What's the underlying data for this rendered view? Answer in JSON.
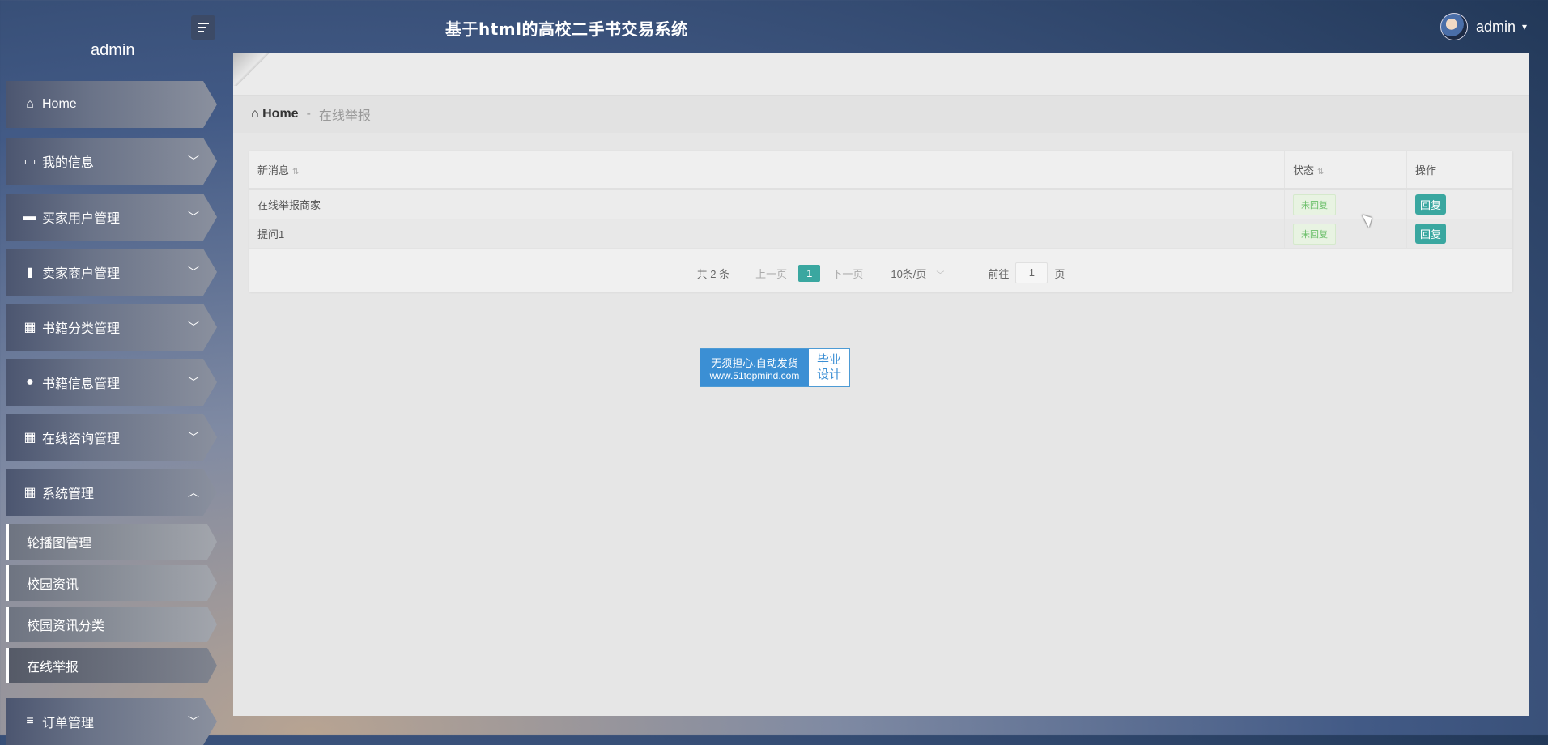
{
  "header": {
    "title": "基于html的高校二手书交易系统",
    "user_name": "admin",
    "caret": "▾"
  },
  "sidebar": {
    "user_label": "admin",
    "items": [
      {
        "label": "Home",
        "icon": "home-icon",
        "glyph": "⌂"
      },
      {
        "label": "我的信息",
        "icon": "card-icon",
        "glyph": "▭"
      },
      {
        "label": "买家用户管理",
        "icon": "monitor-icon",
        "glyph": "▬"
      },
      {
        "label": "卖家商户管理",
        "icon": "book-icon",
        "glyph": "▮"
      },
      {
        "label": "书籍分类管理",
        "icon": "grid-icon",
        "glyph": "▦"
      },
      {
        "label": "书籍信息管理",
        "icon": "user-icon",
        "glyph": "●"
      },
      {
        "label": "在线咨询管理",
        "icon": "grid-icon",
        "glyph": "▦"
      },
      {
        "label": "系统管理",
        "icon": "grid-icon",
        "glyph": "▦"
      },
      {
        "label": "订单管理",
        "icon": "sliders-icon",
        "glyph": "≡"
      }
    ],
    "sub_items": [
      {
        "label": "轮播图管理"
      },
      {
        "label": "校园资讯"
      },
      {
        "label": "校园资讯分类"
      },
      {
        "label": "在线举报"
      }
    ]
  },
  "breadcrumb": {
    "home": "Home",
    "separator": "-",
    "current": "在线举报"
  },
  "table": {
    "columns": [
      "新消息",
      "状态",
      "操作"
    ],
    "rows": [
      {
        "message": "在线举报商家",
        "status": "未回复",
        "action": "回复"
      },
      {
        "message": "提问1",
        "status": "未回复",
        "action": "回复"
      }
    ]
  },
  "pagination": {
    "total": "共 2 条",
    "prev": "上一页",
    "current_page": "1",
    "next": "下一页",
    "page_size": "10条/页",
    "goto_label": "前往",
    "goto_value": "1",
    "page_suffix": "页"
  },
  "watermark": {
    "line1": "无须担心.自动发货",
    "line2": "www.51topmind.com",
    "side1": "毕业",
    "side2": "设计"
  },
  "colors": {
    "accent": "#3aa7a0",
    "status_text": "#6bbf6a"
  }
}
